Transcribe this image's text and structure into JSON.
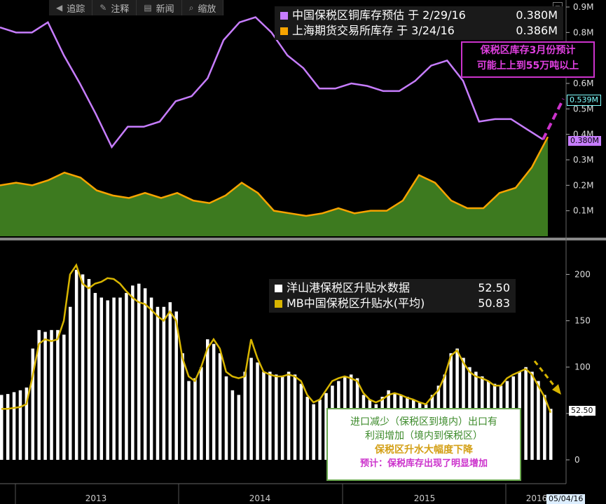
{
  "toolbar": {
    "items": [
      {
        "label": "追踪",
        "icon": "back-icon"
      },
      {
        "label": "注释",
        "icon": "annotate-icon"
      },
      {
        "label": "新闻",
        "icon": "news-icon"
      },
      {
        "label": "缩放",
        "icon": "zoom-icon"
      }
    ]
  },
  "colors": {
    "purple": "#c77dff",
    "orange": "#f7a400",
    "green_fill": "#3d7a1f",
    "gold": "#d8b500",
    "white": "#ffffff",
    "magenta": "#cc33cc",
    "cyan": "#7fffff"
  },
  "top_legend": {
    "rows": [
      {
        "label": "中国保税区铜库存预估 于 2/29/16",
        "value": "0.380M"
      },
      {
        "label": "上海期货交易所库存 于 3/24/16",
        "value": "0.386M"
      }
    ]
  },
  "bottom_legend": {
    "rows": [
      {
        "label": "洋山港保税区升贴水数据",
        "value": "52.50"
      },
      {
        "label": "MB中国保税区升贴水(平均)",
        "value": "50.83"
      }
    ]
  },
  "callout_top": {
    "line1": "保税区库存3月份预计",
    "line2": "可能上上到55万吨以上"
  },
  "callout_bottom": {
    "line1": "进口减少（保税区到境内）出口有",
    "line2": "利润增加（境内到保税区）",
    "line3": "保税区升水大幅度下降",
    "line4": "预计：保税库存出现了明显增加"
  },
  "right_tags": {
    "forecast": "0.539M",
    "current": "0.380M",
    "premium": "52.50"
  },
  "date_tag": "05/04/16",
  "chart_data": [
    {
      "type": "line",
      "title": "",
      "series": [
        {
          "name": "中国保税区铜库存预估",
          "unit": "M",
          "values": [
            0.82,
            0.8,
            0.8,
            0.84,
            0.71,
            0.6,
            0.48,
            0.35,
            0.43,
            0.43,
            0.45,
            0.53,
            0.55,
            0.62,
            0.77,
            0.84,
            0.86,
            0.8,
            0.71,
            0.66,
            0.58,
            0.58,
            0.6,
            0.59,
            0.57,
            0.57,
            0.61,
            0.67,
            0.69,
            0.61,
            0.45,
            0.46,
            0.46,
            0.42,
            0.38
          ],
          "forecast": [
            0.38,
            0.539
          ]
        },
        {
          "name": "上海期货交易所库存",
          "unit": "M",
          "type": "area",
          "values": [
            0.2,
            0.21,
            0.2,
            0.22,
            0.25,
            0.23,
            0.18,
            0.16,
            0.15,
            0.17,
            0.15,
            0.17,
            0.14,
            0.13,
            0.16,
            0.21,
            0.17,
            0.1,
            0.09,
            0.08,
            0.09,
            0.11,
            0.09,
            0.1,
            0.1,
            0.14,
            0.24,
            0.21,
            0.14,
            0.11,
            0.11,
            0.17,
            0.19,
            0.27,
            0.39
          ]
        }
      ],
      "ylim": [
        0,
        0.9
      ],
      "yticks": [
        "0.1M",
        "0.2M",
        "0.3M",
        "0.4M",
        "0.5M",
        "0.6M",
        "0.7M",
        "0.8M",
        "0.9M"
      ]
    },
    {
      "type": "bar",
      "title": "",
      "series": [
        {
          "name": "洋山港保税区升贴水数据",
          "type": "bar",
          "values": [
            70,
            71,
            73,
            75,
            78,
            120,
            140,
            138,
            140,
            140,
            135,
            165,
            205,
            200,
            195,
            180,
            175,
            172,
            175,
            175,
            180,
            188,
            190,
            185,
            175,
            165,
            165,
            170,
            160,
            115,
            85,
            88,
            100,
            130,
            125,
            115,
            90,
            75,
            70,
            95,
            110,
            105,
            95,
            95,
            92,
            90,
            95,
            92,
            82,
            68,
            60,
            65,
            72,
            80,
            85,
            90,
            92,
            88,
            70,
            65,
            60,
            68,
            75,
            72,
            70,
            68,
            65,
            62,
            60,
            70,
            80,
            92,
            115,
            120,
            110,
            100,
            95,
            90,
            85,
            82,
            80,
            85,
            90,
            95,
            100,
            95,
            85,
            70,
            55
          ]
        },
        {
          "name": "MB中国保税区升贴水(平均)",
          "type": "line",
          "values": [
            55,
            55,
            56,
            57,
            60,
            90,
            125,
            130,
            128,
            130,
            150,
            200,
            210,
            190,
            185,
            190,
            192,
            196,
            195,
            190,
            182,
            175,
            170,
            168,
            162,
            155,
            150,
            160,
            150,
            110,
            90,
            85,
            100,
            120,
            130,
            120,
            95,
            90,
            88,
            90,
            130,
            110,
            95,
            92,
            90,
            90,
            92,
            90,
            85,
            70,
            62,
            65,
            75,
            85,
            88,
            90,
            88,
            85,
            72,
            65,
            62,
            65,
            70,
            72,
            70,
            67,
            65,
            62,
            60,
            68,
            75,
            90,
            112,
            118,
            105,
            95,
            90,
            88,
            85,
            80,
            80,
            88,
            92,
            95,
            98,
            92,
            80,
            68,
            50.83
          ]
        }
      ],
      "ylim": [
        0,
        220
      ],
      "yticks": [
        "0",
        "50",
        "100",
        "150",
        "200"
      ]
    }
  ],
  "x_axis": {
    "labels": [
      "2013",
      "2014",
      "2015",
      "2016"
    ]
  }
}
